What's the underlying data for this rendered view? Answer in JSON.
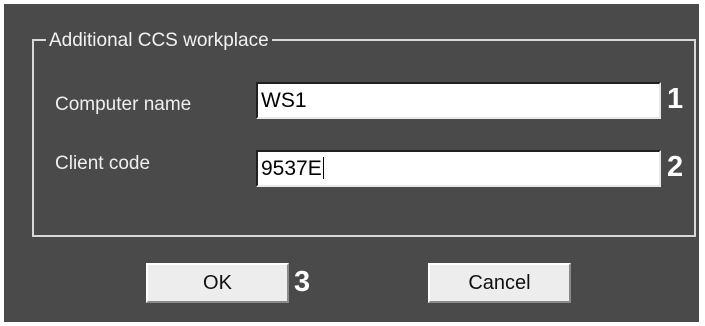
{
  "groupbox": {
    "title": "Additional CCS workplace"
  },
  "fields": [
    {
      "label": "Computer name",
      "value": "WS1",
      "marker": "1"
    },
    {
      "label": "Client code",
      "value": "9537E",
      "marker": "2"
    }
  ],
  "buttons": {
    "ok_label": "OK",
    "ok_marker": "3",
    "cancel_label": "Cancel"
  },
  "colors": {
    "dialog_background": "#4a4a4a",
    "field_background": "#ffffff",
    "button_face": "#ededed"
  }
}
